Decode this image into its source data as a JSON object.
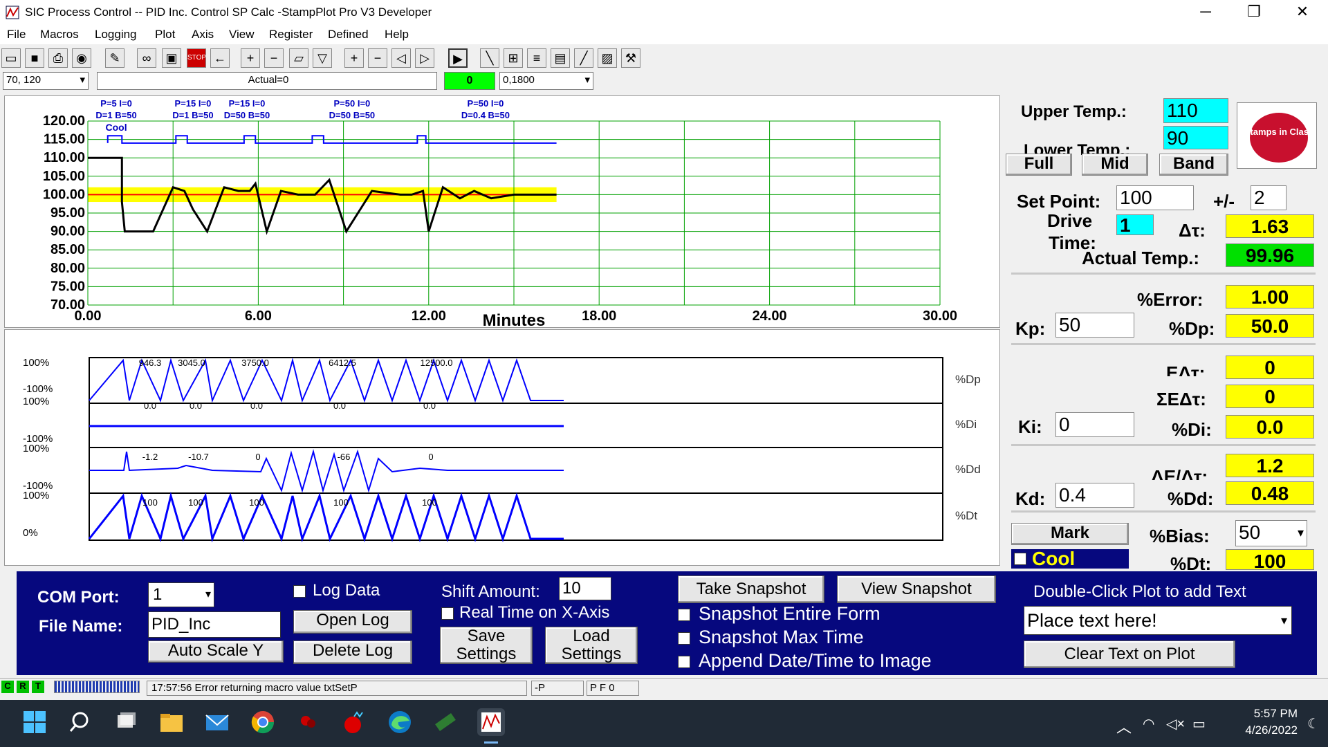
{
  "window": {
    "title": "SIC Process Control -- PID Inc. Control SP Calc -StampPlot Pro V3 Developer",
    "minimize": "─",
    "maximize": "❐",
    "close": "✕"
  },
  "menu": [
    "File",
    "Macros",
    "Logging",
    "Plot",
    "Axis",
    "View",
    "Register",
    "Defined",
    "Help"
  ],
  "toolbar": {
    "icons": [
      "open-icon",
      "save-icon",
      "print-icon",
      "camera-icon",
      "wand-icon",
      "glasses-icon",
      "monitor-icon",
      "stop-icon",
      "arrow-left-icon",
      "plus-icon",
      "minus-icon",
      "zoom-box-icon",
      "filter-icon",
      "plus-icon",
      "minus-icon",
      "scroll-left-icon",
      "scroll-right-icon",
      "play-icon",
      "pencil-icon",
      "grid-icon",
      "notes-icon",
      "clipboard-icon",
      "probe-icon",
      "image-icon",
      "wrench-icon"
    ],
    "coord_value": "70, 120",
    "actual_text": "Actual=0",
    "counter": "0",
    "range_value": "0,1800"
  },
  "chart_data": [
    {
      "type": "line",
      "xlabel": "Minutes",
      "x_ticks": [
        "0.00",
        "6.00",
        "12.00",
        "18.00",
        "24.00",
        "30.00"
      ],
      "xlim": [
        0,
        30
      ],
      "y_ticks": [
        "120.00",
        "115.00",
        "110.00",
        "105.00",
        "100.00",
        "95.00",
        "90.00",
        "85.00",
        "80.00",
        "75.00",
        "70.00"
      ],
      "ylim": [
        70,
        120
      ],
      "annotations": [
        "P=5 I=0",
        "D=1 B=50",
        "P=15 I=0",
        "D=1 B=50",
        "P=15 I=0",
        "D=50 B=50",
        "P=50 I=0",
        "D=50 B=50",
        "P=50 I=0",
        "D=0.4 B=50",
        "Cool"
      ],
      "band": {
        "low": 98,
        "high": 102,
        "color": "#ffff00"
      },
      "series": [
        {
          "color": "#0000ff",
          "x": [
            0.7,
            0.7,
            1.2,
            1.2,
            3.1,
            3.1,
            3.5,
            3.5,
            5.5,
            5.5,
            5.9,
            5.9,
            7.9,
            7.9,
            8.3,
            8.3,
            11.6,
            11.6,
            11.9,
            11.9,
            16.5
          ],
          "values": [
            114,
            116,
            116,
            114,
            114,
            116,
            116,
            114,
            114,
            116,
            116,
            114,
            114,
            116,
            116,
            114,
            114,
            116,
            116,
            114,
            114
          ]
        },
        {
          "color": "#ff0000",
          "x": [
            0,
            16.5
          ],
          "values": [
            100,
            100
          ]
        },
        {
          "color": "#000000",
          "x": [
            0,
            1.2,
            1.2,
            1.3,
            2.3,
            3.0,
            3.4,
            3.7,
            4.2,
            4.8,
            5.3,
            5.7,
            5.9,
            6.3,
            6.8,
            7.4,
            8.0,
            8.5,
            9.1,
            10.0,
            11.0,
            11.4,
            11.8,
            12.0,
            12.5,
            13.1,
            13.6,
            14.2,
            15.0,
            16.5
          ],
          "values": [
            110,
            110,
            98,
            90,
            90,
            102,
            101,
            96,
            90,
            102,
            101,
            101,
            103,
            90,
            101,
            100,
            100,
            104,
            90,
            101,
            100,
            100,
            101,
            90,
            102,
            99,
            101,
            99,
            100,
            100
          ]
        }
      ]
    },
    {
      "type": "line",
      "name": "PID output",
      "row_labels": [
        "%Dp",
        "%Di",
        "%Dd",
        "%Dt"
      ],
      "y_labels": [
        "100%",
        "-100%",
        "100%",
        "-100%",
        "100%",
        "-100%",
        "100%",
        "0%"
      ],
      "value_labels": [
        "946.3",
        "3045.0",
        "3750.0",
        "6412.5",
        "12500.0",
        "0.0",
        "0.0",
        "0.0",
        "0.0",
        "0.0",
        "-1.2",
        "-10.7",
        "0",
        "-66",
        "0",
        "100",
        "100",
        "100",
        "100",
        "100"
      ]
    }
  ],
  "right": {
    "upper_label": "Upper Temp.:",
    "upper_value": "110",
    "lower_label": "Lower Temp.:",
    "lower_value": "90",
    "full": "Full",
    "mid": "Mid",
    "band": "Band",
    "logo_text": "Stamps in Class",
    "setpoint_label": "Set Point:",
    "setpoint_value": "100",
    "pm_label": "+/-",
    "pm_value": "2",
    "drive_label": "Drive",
    "time_label": "Time:",
    "drive_value": "1",
    "dt_label": "Δτ:",
    "dt_value": "1.63",
    "actual_label": "Actual Temp.:",
    "actual_value": "99.96",
    "error_label": "%Error:",
    "error_value": "1.00",
    "kp_label": "Kp:",
    "kp_value": "50",
    "dp_label": "%Dp:",
    "dp_value": "50.0",
    "edt_label": "EΔτ:",
    "edt_value": "0",
    "sedt_label": "ΣEΔτ:",
    "sedt_value": "0",
    "ki_label": "Ki:",
    "ki_value": "0",
    "di_label": "%Di:",
    "di_value": "0.0",
    "dedt_label": "ΔE/Δτ:",
    "dedt_value": "1.2",
    "kd_label": "Kd:",
    "kd_value": "0.4",
    "dd_label": "%Dd:",
    "dd_value": "0.48",
    "mark": "Mark",
    "bias_label": "%Bias:",
    "bias_value": "50",
    "cool_label": "Cool",
    "dtot_label": "%Dt:",
    "dtot_value": "100"
  },
  "bottom": {
    "com_label": "COM Port:",
    "com_value": "1",
    "file_label": "File Name:",
    "file_value": "PID_Inc",
    "autoscale": "Auto Scale Y",
    "logdata": "Log Data",
    "openlog": "Open Log",
    "deletelog": "Delete Log",
    "shift_label": "Shift Amount:",
    "shift_value": "10",
    "realtime": "Real Time on X-Axis",
    "save1": "Save",
    "save2": "Settings",
    "load1": "Load",
    "load2": "Settings",
    "take": "Take Snapshot",
    "view": "View Snapshot",
    "snap_entire": "Snapshot Entire Form",
    "snap_max": "Snapshot Max Time",
    "append": "Append Date/Time to Image",
    "dbl_label": "Double-Click Plot to add Text",
    "text_value": "Place text here!",
    "clear": "Clear Text on Plot"
  },
  "status": {
    "c": "C",
    "r": "R",
    "t": "T",
    "message": "17:57:56 Error returning macro value txtSetP",
    "p": "-P",
    "pf": "P F 0"
  },
  "taskbar": {
    "time": "5:57 PM",
    "date": "4/26/2022"
  }
}
